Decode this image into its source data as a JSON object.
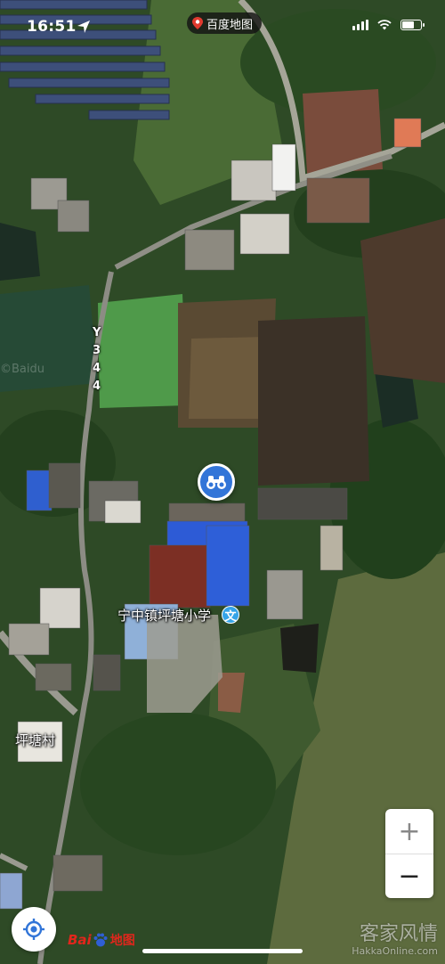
{
  "status_bar": {
    "time": "16:51",
    "app_name": "百度地图",
    "icons": [
      "location-arrow-icon",
      "signal-icon",
      "wifi-icon",
      "battery-icon"
    ]
  },
  "map": {
    "view": "satellite",
    "road_label": [
      "Y",
      "3",
      "4",
      "4"
    ],
    "places": {
      "school": "宁中镇坪塘小学",
      "village": "坪塘村"
    },
    "school_icon_text": "文",
    "faint_watermark": "©Baidu"
  },
  "controls": {
    "zoom_in": "+",
    "zoom_out": "−",
    "streetview_icon": "binoculars-icon",
    "locate_icon": "locate-icon"
  },
  "brand": {
    "part1": "Bai",
    "part2": "du",
    "part3": "地图"
  },
  "site_watermark": {
    "text": "客家风情",
    "url": "HakkaOnline.com"
  }
}
